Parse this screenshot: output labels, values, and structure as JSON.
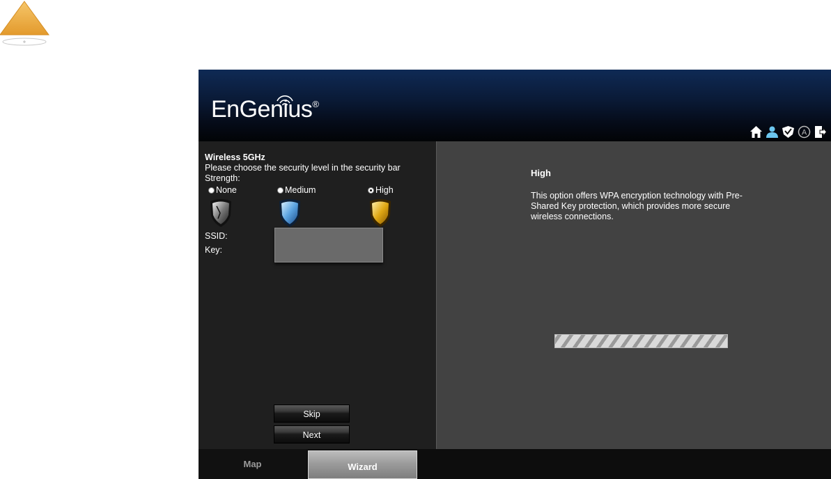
{
  "app": {
    "brand": "EnGenius",
    "brand_mark": "®",
    "toolbar_icons": [
      "home-icon",
      "user-icon",
      "shield-check-icon",
      "auto-update-icon",
      "logout-icon"
    ]
  },
  "left_panel": {
    "title": "Wireless 5GHz",
    "instruction": "Please choose the security level in the security bar",
    "strength_label": "Strength:",
    "options": [
      {
        "label": "None",
        "checked": false,
        "color": "#9a9a9a"
      },
      {
        "label": "Medium",
        "checked": false,
        "color": "#5aa2e0"
      },
      {
        "label": "High",
        "checked": true,
        "color": "#e0a814"
      }
    ],
    "ssid_label": "SSID:",
    "key_label": "Key:",
    "skip_label": "Skip",
    "next_label": "Next"
  },
  "right_panel": {
    "title": "High",
    "description": "This option offers WPA encryption technology with Pre-Shared Key protection, which provides more secure wireless connections."
  },
  "tabs": {
    "map": "Map",
    "wizard": "Wizard"
  }
}
